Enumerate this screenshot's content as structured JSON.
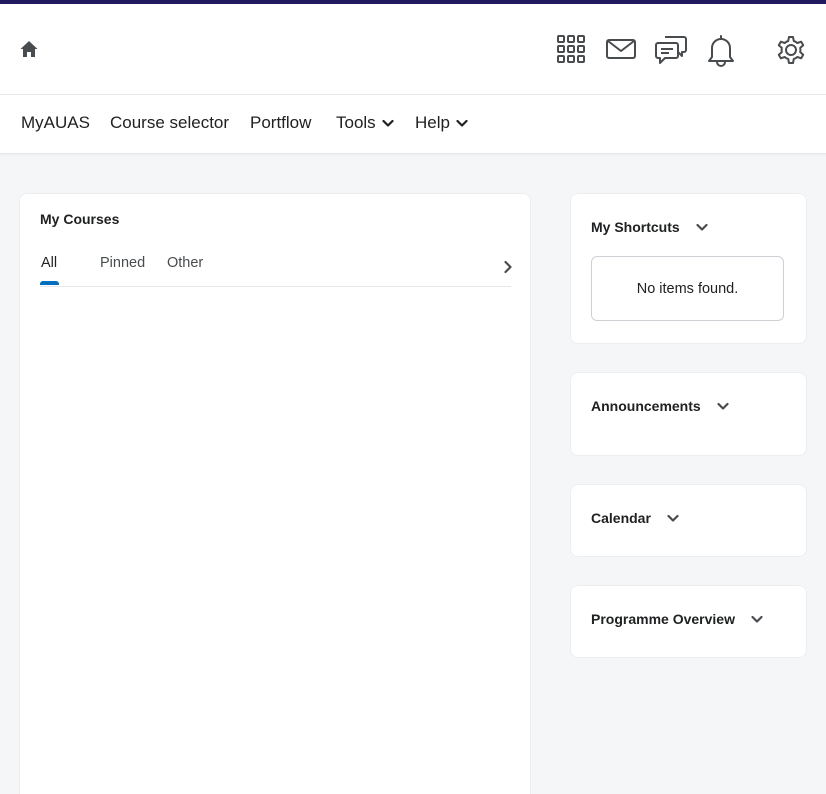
{
  "colors": {
    "accent_bar": "#221a5e",
    "tab_indicator": "#006fbf",
    "page_background": "#f5f6f8"
  },
  "header": {
    "icons": [
      "home-icon",
      "apps-grid-icon",
      "mail-icon",
      "chat-icon",
      "bell-icon",
      "gear-icon"
    ]
  },
  "nav": {
    "items": [
      {
        "label": "MyAUAS"
      },
      {
        "label": "Course selector"
      },
      {
        "label": "Portflow"
      },
      {
        "label": "Tools",
        "has_dropdown": true
      },
      {
        "label": "Help",
        "has_dropdown": true
      }
    ]
  },
  "my_courses": {
    "title": "My Courses",
    "tabs": [
      {
        "label": "All",
        "selected": true
      },
      {
        "label": "Pinned"
      },
      {
        "label": "Other"
      }
    ]
  },
  "widgets": {
    "shortcuts": {
      "title": "My Shortcuts",
      "empty_text": "No items found."
    },
    "announcements": {
      "title": "Announcements"
    },
    "calendar": {
      "title": "Calendar"
    },
    "programme": {
      "title": "Programme Overview"
    }
  }
}
